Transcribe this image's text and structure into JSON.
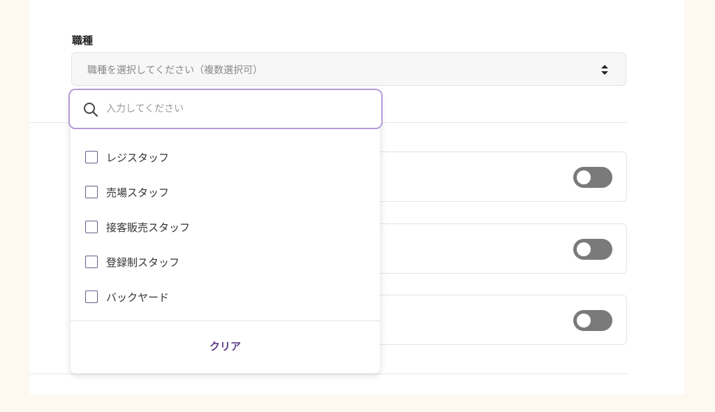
{
  "job_type": {
    "label": "職種",
    "placeholder": "職種を選択してください（複数選択可）"
  },
  "dropdown": {
    "search_placeholder": "入力してください",
    "options": [
      {
        "label": "レジスタッフ",
        "checked": false
      },
      {
        "label": "売場スタッフ",
        "checked": false
      },
      {
        "label": "接客販売スタッフ",
        "checked": false
      },
      {
        "label": "登録制スタッフ",
        "checked": false
      },
      {
        "label": "バックヤード",
        "checked": false
      }
    ],
    "clear_label": "クリア"
  },
  "toggles": [
    {
      "on": false
    },
    {
      "on": false
    },
    {
      "on": false
    }
  ],
  "colors": {
    "accent": "#5b3d85",
    "focus_border": "#b79ad8",
    "toggle_off": "#7a7a7a",
    "background": "#fdf8f0"
  }
}
